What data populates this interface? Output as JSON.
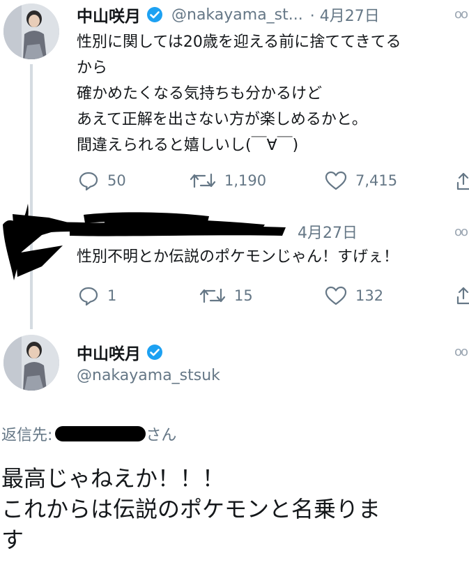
{
  "tweet1": {
    "name": "中山咲月",
    "handle": "@nakayama_st...",
    "date": "· 4月27日",
    "lines": [
      "性別に関しては20歳を迎える前に捨ててきてる",
      "から",
      "確かめたくなる気持ちも分かるけど",
      "あえて正解を出さない方が楽しめるかと。",
      "間違えられると嬉しいし(￣∀￣)"
    ],
    "reply_count": "50",
    "retweet_count": "1,190",
    "like_count": "7,415"
  },
  "tweet2": {
    "date": "4月27日",
    "text": "性別不明とか伝説のポケモンじゃん！すげぇ！",
    "reply_count": "1",
    "retweet_count": "15",
    "like_count": "132"
  },
  "tweet3": {
    "name": "中山咲月",
    "handle": "@nakayama_stsuk",
    "reply_prefix": "返信先:",
    "reply_suffix": "さん",
    "lines": [
      "最高じゃねえか！！！",
      "これからは伝説のポケモンと名乗りま",
      "す"
    ]
  },
  "icons": [
    "verified-icon",
    "more-icon",
    "reply-icon",
    "retweet-icon",
    "like-icon",
    "share-icon"
  ],
  "colors": {
    "verified": "#1da1f2",
    "secondary_text": "#657786",
    "thread_line": "#d5dbe1"
  }
}
